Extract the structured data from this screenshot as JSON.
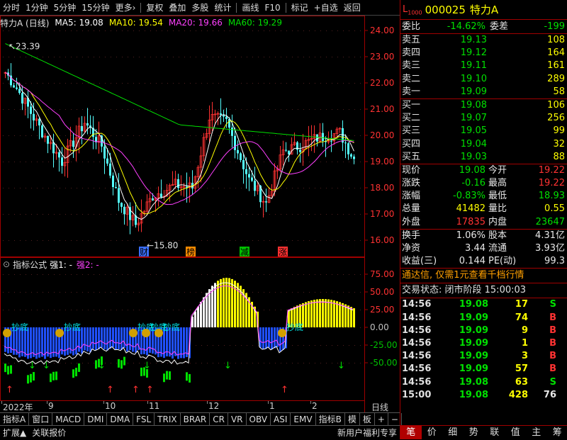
{
  "toolbar": {
    "items": [
      "分时",
      "1分钟",
      "5分钟",
      "15分钟",
      "更多›",
      "复权",
      "叠加",
      "多股",
      "统计",
      "画线",
      "F10",
      "标记",
      "+自选",
      "返回"
    ]
  },
  "stock": {
    "title": "特力A (日线)",
    "code": "000025",
    "name": "特力A",
    "marker": "L",
    "marker_sub": "1000"
  },
  "ma": {
    "ma5": "MA5: 19.08",
    "ma10": "MA10: 19.54",
    "ma20": "MA20: 19.66",
    "ma60": "MA60: 19.29"
  },
  "price_axis": [
    "24.00",
    "23.00",
    "22.00",
    "21.00",
    "20.00",
    "19.00",
    "18.00",
    "17.00",
    "16.00"
  ],
  "price_annotations": {
    "high": "23.39",
    "low": "15.80"
  },
  "event_tags": [
    {
      "text": "财",
      "color": "#3a6eff"
    },
    {
      "text": "榜",
      "color": "#ff8c00"
    },
    {
      "text": "减",
      "color": "#00c000"
    },
    {
      "text": "涨",
      "color": "#ff3232"
    }
  ],
  "indicator": {
    "name": "指标公式",
    "line1": "强1: -",
    "line2": "强2: -",
    "axis": [
      "75.00",
      "50.00",
      "25.00",
      "0.00",
      "-25.00",
      "-50.00"
    ],
    "buy_label": "抄底",
    "buy_count": 6
  },
  "dates": [
    "2022年",
    "9",
    "10",
    "11",
    "12",
    "1",
    "2"
  ],
  "date_tab": "日线",
  "tabs": [
    "指标A",
    "窗口",
    "MACD",
    "DMI",
    "DMA",
    "FSL",
    "TRIX",
    "BRAR",
    "CR",
    "VR",
    "OBV",
    "ASI",
    "EMV",
    "指标B",
    "模",
    "板",
    "+",
    "−"
  ],
  "bottom": {
    "left1": "扩展▲",
    "left2": "关联报价",
    "right": "新用户福利专享"
  },
  "quote": {
    "weibi_label": "委比",
    "weibi": "-14.62%",
    "weicha_label": "委差",
    "weicha": "-199",
    "sell": [
      {
        "label": "卖五",
        "price": "19.13",
        "vol": "108"
      },
      {
        "label": "卖四",
        "price": "19.12",
        "vol": "164"
      },
      {
        "label": "卖三",
        "price": "19.11",
        "vol": "161"
      },
      {
        "label": "卖二",
        "price": "19.10",
        "vol": "289"
      },
      {
        "label": "卖一",
        "price": "19.09",
        "vol": "58"
      }
    ],
    "buy": [
      {
        "label": "买一",
        "price": "19.08",
        "vol": "106"
      },
      {
        "label": "买二",
        "price": "19.07",
        "vol": "256"
      },
      {
        "label": "买三",
        "price": "19.05",
        "vol": "99"
      },
      {
        "label": "买四",
        "price": "19.04",
        "vol": "32"
      },
      {
        "label": "买五",
        "price": "19.03",
        "vol": "88"
      }
    ],
    "stats": [
      {
        "l1": "现价",
        "v1": "19.08",
        "c1": "green",
        "l2": "今开",
        "v2": "19.22",
        "c2": "red"
      },
      {
        "l1": "涨跌",
        "v1": "-0.16",
        "c1": "green",
        "l2": "最高",
        "v2": "19.22",
        "c2": "red"
      },
      {
        "l1": "涨幅",
        "v1": "-0.83%",
        "c1": "green",
        "l2": "最低",
        "v2": "18.93",
        "c2": "green"
      },
      {
        "l1": "总量",
        "v1": "41482",
        "c1": "yellow",
        "l2": "量比",
        "v2": "0.55",
        "c2": "yellow"
      },
      {
        "l1": "外盘",
        "v1": "17835",
        "c1": "red",
        "l2": "内盘",
        "v2": "23647",
        "c2": "green"
      }
    ],
    "stats2": [
      {
        "l1": "换手",
        "v1": "1.06%",
        "l2": "股本",
        "v2": "4.31亿"
      },
      {
        "l1": "净资",
        "v1": "3.44",
        "l2": "流通",
        "v2": "3.93亿"
      },
      {
        "l1": "收益(三)",
        "v1": "0.144",
        "l2": "PE(动)",
        "v2": "99.3"
      }
    ],
    "promo": "通达信, 仅需1元查看千档行情",
    "status": "交易状态: 闭市阶段 15:00:03",
    "ticks": [
      {
        "t": "14:56",
        "p": "19.08",
        "v": "17",
        "s": "S"
      },
      {
        "t": "14:56",
        "p": "19.09",
        "v": "74",
        "s": "B"
      },
      {
        "t": "14:56",
        "p": "19.09",
        "v": "9",
        "s": "B"
      },
      {
        "t": "14:56",
        "p": "19.09",
        "v": "1",
        "s": "B"
      },
      {
        "t": "14:56",
        "p": "19.09",
        "v": "3",
        "s": "B"
      },
      {
        "t": "14:56",
        "p": "19.09",
        "v": "57",
        "s": "B"
      },
      {
        "t": "14:56",
        "p": "19.08",
        "v": "63",
        "s": "S"
      },
      {
        "t": "15:00",
        "p": "19.08",
        "v": "428",
        "s": "76"
      }
    ],
    "tabs": [
      "笔",
      "价",
      "细",
      "势",
      "联",
      "值",
      "主",
      "筹"
    ]
  }
}
